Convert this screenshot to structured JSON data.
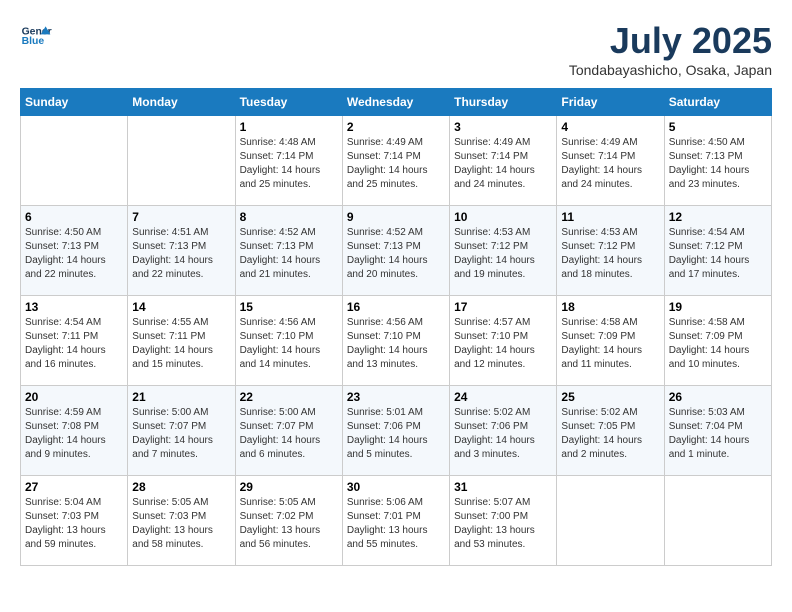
{
  "header": {
    "logo_line1": "General",
    "logo_line2": "Blue",
    "month": "July 2025",
    "location": "Tondabayashicho, Osaka, Japan"
  },
  "columns": [
    "Sunday",
    "Monday",
    "Tuesday",
    "Wednesday",
    "Thursday",
    "Friday",
    "Saturday"
  ],
  "weeks": [
    [
      {
        "day": "",
        "info": ""
      },
      {
        "day": "",
        "info": ""
      },
      {
        "day": "1",
        "info": "Sunrise: 4:48 AM\nSunset: 7:14 PM\nDaylight: 14 hours and 25 minutes."
      },
      {
        "day": "2",
        "info": "Sunrise: 4:49 AM\nSunset: 7:14 PM\nDaylight: 14 hours and 25 minutes."
      },
      {
        "day": "3",
        "info": "Sunrise: 4:49 AM\nSunset: 7:14 PM\nDaylight: 14 hours and 24 minutes."
      },
      {
        "day": "4",
        "info": "Sunrise: 4:49 AM\nSunset: 7:14 PM\nDaylight: 14 hours and 24 minutes."
      },
      {
        "day": "5",
        "info": "Sunrise: 4:50 AM\nSunset: 7:13 PM\nDaylight: 14 hours and 23 minutes."
      }
    ],
    [
      {
        "day": "6",
        "info": "Sunrise: 4:50 AM\nSunset: 7:13 PM\nDaylight: 14 hours and 22 minutes."
      },
      {
        "day": "7",
        "info": "Sunrise: 4:51 AM\nSunset: 7:13 PM\nDaylight: 14 hours and 22 minutes."
      },
      {
        "day": "8",
        "info": "Sunrise: 4:52 AM\nSunset: 7:13 PM\nDaylight: 14 hours and 21 minutes."
      },
      {
        "day": "9",
        "info": "Sunrise: 4:52 AM\nSunset: 7:13 PM\nDaylight: 14 hours and 20 minutes."
      },
      {
        "day": "10",
        "info": "Sunrise: 4:53 AM\nSunset: 7:12 PM\nDaylight: 14 hours and 19 minutes."
      },
      {
        "day": "11",
        "info": "Sunrise: 4:53 AM\nSunset: 7:12 PM\nDaylight: 14 hours and 18 minutes."
      },
      {
        "day": "12",
        "info": "Sunrise: 4:54 AM\nSunset: 7:12 PM\nDaylight: 14 hours and 17 minutes."
      }
    ],
    [
      {
        "day": "13",
        "info": "Sunrise: 4:54 AM\nSunset: 7:11 PM\nDaylight: 14 hours and 16 minutes."
      },
      {
        "day": "14",
        "info": "Sunrise: 4:55 AM\nSunset: 7:11 PM\nDaylight: 14 hours and 15 minutes."
      },
      {
        "day": "15",
        "info": "Sunrise: 4:56 AM\nSunset: 7:10 PM\nDaylight: 14 hours and 14 minutes."
      },
      {
        "day": "16",
        "info": "Sunrise: 4:56 AM\nSunset: 7:10 PM\nDaylight: 14 hours and 13 minutes."
      },
      {
        "day": "17",
        "info": "Sunrise: 4:57 AM\nSunset: 7:10 PM\nDaylight: 14 hours and 12 minutes."
      },
      {
        "day": "18",
        "info": "Sunrise: 4:58 AM\nSunset: 7:09 PM\nDaylight: 14 hours and 11 minutes."
      },
      {
        "day": "19",
        "info": "Sunrise: 4:58 AM\nSunset: 7:09 PM\nDaylight: 14 hours and 10 minutes."
      }
    ],
    [
      {
        "day": "20",
        "info": "Sunrise: 4:59 AM\nSunset: 7:08 PM\nDaylight: 14 hours and 9 minutes."
      },
      {
        "day": "21",
        "info": "Sunrise: 5:00 AM\nSunset: 7:07 PM\nDaylight: 14 hours and 7 minutes."
      },
      {
        "day": "22",
        "info": "Sunrise: 5:00 AM\nSunset: 7:07 PM\nDaylight: 14 hours and 6 minutes."
      },
      {
        "day": "23",
        "info": "Sunrise: 5:01 AM\nSunset: 7:06 PM\nDaylight: 14 hours and 5 minutes."
      },
      {
        "day": "24",
        "info": "Sunrise: 5:02 AM\nSunset: 7:06 PM\nDaylight: 14 hours and 3 minutes."
      },
      {
        "day": "25",
        "info": "Sunrise: 5:02 AM\nSunset: 7:05 PM\nDaylight: 14 hours and 2 minutes."
      },
      {
        "day": "26",
        "info": "Sunrise: 5:03 AM\nSunset: 7:04 PM\nDaylight: 14 hours and 1 minute."
      }
    ],
    [
      {
        "day": "27",
        "info": "Sunrise: 5:04 AM\nSunset: 7:03 PM\nDaylight: 13 hours and 59 minutes."
      },
      {
        "day": "28",
        "info": "Sunrise: 5:05 AM\nSunset: 7:03 PM\nDaylight: 13 hours and 58 minutes."
      },
      {
        "day": "29",
        "info": "Sunrise: 5:05 AM\nSunset: 7:02 PM\nDaylight: 13 hours and 56 minutes."
      },
      {
        "day": "30",
        "info": "Sunrise: 5:06 AM\nSunset: 7:01 PM\nDaylight: 13 hours and 55 minutes."
      },
      {
        "day": "31",
        "info": "Sunrise: 5:07 AM\nSunset: 7:00 PM\nDaylight: 13 hours and 53 minutes."
      },
      {
        "day": "",
        "info": ""
      },
      {
        "day": "",
        "info": ""
      }
    ]
  ]
}
